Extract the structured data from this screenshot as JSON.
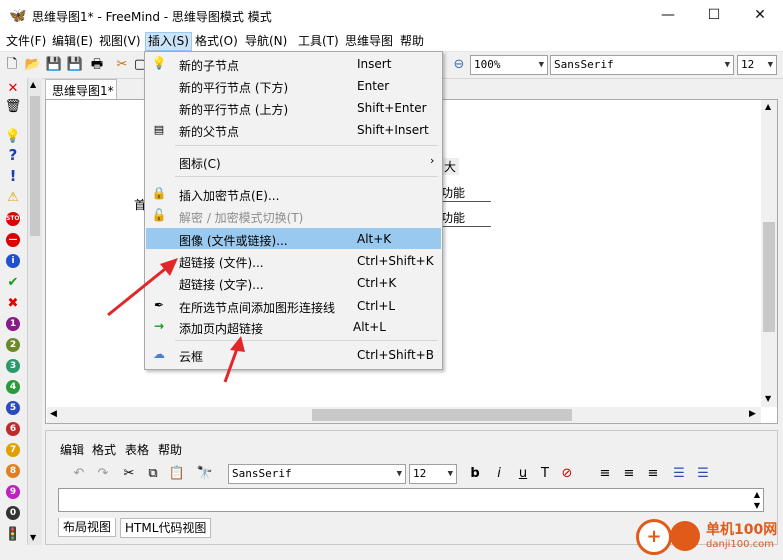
{
  "window": {
    "title": "思维导图1* - FreeMind - 思维导图模式 模式",
    "minimize": "—",
    "maximize": "☐",
    "close": "✕"
  },
  "menubar": {
    "items": [
      "文件(F)",
      "编辑(E)",
      "视图(V)",
      "插入(S)",
      "格式(O)",
      "导航(N)",
      "工具(T)",
      "思维导图",
      "帮助"
    ],
    "active": "插入(S)"
  },
  "toolbar": {
    "zoom": "100%",
    "font": "SansSerif",
    "size": "12"
  },
  "tabs": {
    "map_tab": "思维导图1*"
  },
  "canvas": {
    "node_fragments": [
      "大",
      "功能",
      "功能",
      "首"
    ]
  },
  "insert_menu": {
    "items": [
      {
        "icon": "lightbulb-icon",
        "label": "新的子节点",
        "shortcut": "Insert"
      },
      {
        "icon": "",
        "label": "新的平行节点 (下方)",
        "shortcut": "Enter"
      },
      {
        "icon": "",
        "label": "新的平行节点 (上方)",
        "shortcut": "Shift+Enter"
      },
      {
        "icon": "parent-node-icon",
        "label": "新的父节点",
        "shortcut": "Shift+Insert"
      },
      {
        "icon": "",
        "label": "图标(C)",
        "shortcut": "",
        "submenu": true
      },
      {
        "icon": "lock-icon",
        "label": "插入加密节点(E)...",
        "shortcut": ""
      },
      {
        "icon": "unlock-icon",
        "label": "解密 / 加密模式切换(T)",
        "shortcut": "",
        "disabled": true
      },
      {
        "icon": "",
        "label": "图像 (文件或链接)...",
        "shortcut": "Alt+K",
        "highlighted": true
      },
      {
        "icon": "",
        "label": "超链接 (文件)...",
        "shortcut": "Ctrl+Shift+K"
      },
      {
        "icon": "",
        "label": "超链接 (文字)...",
        "shortcut": "Ctrl+K"
      },
      {
        "icon": "connector-icon",
        "label": "在所选节点间添加图形连接线",
        "shortcut": "Ctrl+L"
      },
      {
        "icon": "green-arrow-icon",
        "label": "添加页内超链接",
        "shortcut": "Alt+L"
      },
      {
        "icon": "cloud-icon",
        "label": "云框",
        "shortcut": "Ctrl+Shift+B"
      }
    ]
  },
  "editor": {
    "menu": [
      "编辑",
      "格式",
      "表格",
      "帮助"
    ],
    "font": "SansSerif",
    "size": "12",
    "tabs": [
      "布局视图",
      "HTML代码视图"
    ]
  },
  "watermark": {
    "site": "单机100网",
    "url": "danji100.com"
  },
  "colors": {
    "highlight": "#99c9ef",
    "arrow": "#e0282a",
    "menu_active": "#cce4f7"
  }
}
